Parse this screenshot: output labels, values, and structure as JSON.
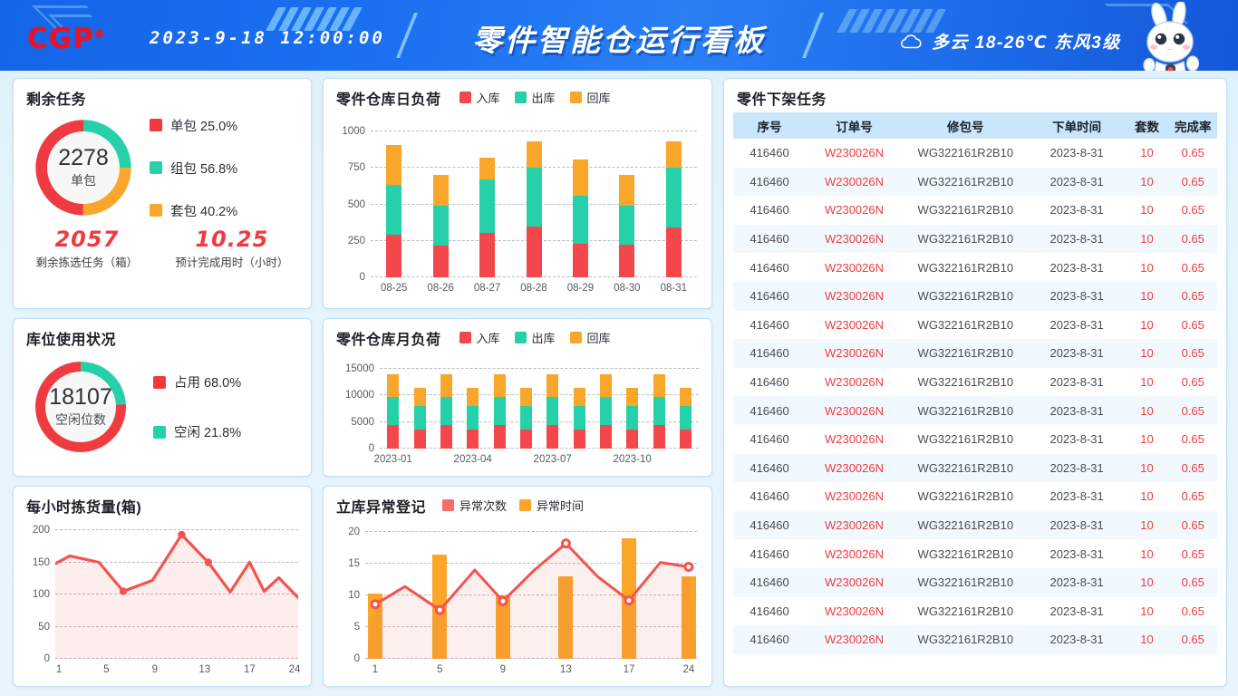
{
  "header": {
    "logo_text": "CGP",
    "logo_mark": "®",
    "datetime": "2023-9-18  12:00:00",
    "title": "零件智能仓运行看板",
    "weather_icon": "cloud-icon",
    "weather": "多云  18-26℃  东风3级",
    "mascot": "rabbit-mascot"
  },
  "remaining_tasks": {
    "title": "剩余任务",
    "donut": {
      "center_value": "2278",
      "center_label": "单包",
      "legend": [
        {
          "label": "单包 25.0%",
          "color": "#ef3b3f",
          "value": 25.0
        },
        {
          "label": "组包 56.8%",
          "color": "#26d0a8",
          "value": 56.8
        },
        {
          "label": "套包 40.2%",
          "color": "#f9a battery",
          "value": 40.2
        }
      ]
    },
    "kpis": [
      {
        "value": "2057",
        "label": "剩余拣选任务（箱）"
      },
      {
        "value": "10.25",
        "label": "预计完成用时（小时）"
      }
    ]
  },
  "location_usage": {
    "title": "库位使用状况",
    "donut": {
      "center_value": "18107",
      "center_label": "空闲位数",
      "legend": [
        {
          "label": "占用 68.0%",
          "color": "#ef3b3f",
          "value": 68.0
        },
        {
          "label": "空闲 21.8%",
          "color": "#26d0a8",
          "value": 21.8
        }
      ]
    }
  },
  "hourly_picking": {
    "title": "每小时拣货量(箱)"
  },
  "daily_load": {
    "title": "零件仓库日负荷"
  },
  "monthly_load": {
    "title": "零件仓库月负荷"
  },
  "anomaly": {
    "title": "立库异常登记"
  },
  "unload_table": {
    "title": "零件下架任务",
    "columns": [
      "序号",
      "订单号",
      "修包号",
      "下单时间",
      "套数",
      "完成率"
    ],
    "rows": [
      [
        "416460",
        "W230026N",
        "WG322161R2B10",
        "2023-8-31",
        "10",
        "0.65"
      ],
      [
        "416460",
        "W230026N",
        "WG322161R2B10",
        "2023-8-31",
        "10",
        "0.65"
      ],
      [
        "416460",
        "W230026N",
        "WG322161R2B10",
        "2023-8-31",
        "10",
        "0.65"
      ],
      [
        "416460",
        "W230026N",
        "WG322161R2B10",
        "2023-8-31",
        "10",
        "0.65"
      ],
      [
        "416460",
        "W230026N",
        "WG322161R2B10",
        "2023-8-31",
        "10",
        "0.65"
      ],
      [
        "416460",
        "W230026N",
        "WG322161R2B10",
        "2023-8-31",
        "10",
        "0.65"
      ],
      [
        "416460",
        "W230026N",
        "WG322161R2B10",
        "2023-8-31",
        "10",
        "0.65"
      ],
      [
        "416460",
        "W230026N",
        "WG322161R2B10",
        "2023-8-31",
        "10",
        "0.65"
      ],
      [
        "416460",
        "W230026N",
        "WG322161R2B10",
        "2023-8-31",
        "10",
        "0.65"
      ],
      [
        "416460",
        "W230026N",
        "WG322161R2B10",
        "2023-8-31",
        "10",
        "0.65"
      ],
      [
        "416460",
        "W230026N",
        "WG322161R2B10",
        "2023-8-31",
        "10",
        "0.65"
      ],
      [
        "416460",
        "W230026N",
        "WG322161R2B10",
        "2023-8-31",
        "10",
        "0.65"
      ],
      [
        "416460",
        "W230026N",
        "WG322161R2B10",
        "2023-8-31",
        "10",
        "0.65"
      ],
      [
        "416460",
        "W230026N",
        "WG322161R2B10",
        "2023-8-31",
        "10",
        "0.65"
      ],
      [
        "416460",
        "W230026N",
        "WG322161R2B10",
        "2023-8-31",
        "10",
        "0.65"
      ],
      [
        "416460",
        "W230026N",
        "WG322161R2B10",
        "2023-8-31",
        "10",
        "0.65"
      ],
      [
        "416460",
        "W230026N",
        "WG322161R2B10",
        "2023-8-31",
        "10",
        "0.65"
      ],
      [
        "416460",
        "W230026N",
        "WG322161R2B10",
        "2023-8-31",
        "10",
        "0.65"
      ]
    ]
  },
  "colors": {
    "in": "#f4474b",
    "out": "#26d0a8",
    "back": "#f9a62b",
    "line": "#f4534f",
    "accent": "#ef3b3f",
    "header_blue": "#1a6ef0",
    "table_head": "#c9e6fa"
  },
  "chart_data": [
    {
      "id": "remaining_tasks_donut",
      "type": "pie",
      "title": "剩余任务",
      "labels": [
        "单包",
        "组包",
        "套包"
      ],
      "values": [
        25.0,
        56.8,
        40.2
      ],
      "display_percent": [
        "25.0%",
        "56.8%",
        "40.2%"
      ],
      "colors": [
        "#ef3b3f",
        "#26d0a8",
        "#f9a62b"
      ],
      "arc_fractions": [
        0.5,
        0.25,
        0.25
      ],
      "center_value": 2278,
      "center_label": "单包",
      "legend_position": "right"
    },
    {
      "id": "location_usage_donut",
      "type": "pie",
      "title": "库位使用状况",
      "labels": [
        "占用",
        "空闲"
      ],
      "values": [
        68.0,
        21.8
      ],
      "display_percent": [
        "68.0%",
        "21.8%"
      ],
      "colors": [
        "#ef3b3f",
        "#26d0a8"
      ],
      "arc_fractions": [
        0.76,
        0.24
      ],
      "center_value": 18107,
      "center_label": "空闲位数",
      "legend_position": "right"
    },
    {
      "id": "hourly_picking",
      "type": "line",
      "title": "每小时拣货量(箱)",
      "x": [
        1,
        5,
        9,
        13,
        17,
        24
      ],
      "xlabel": "",
      "ylabel": "",
      "ylim": [
        0,
        200
      ],
      "yticks": [
        0,
        50,
        100,
        150,
        200
      ],
      "grid": true,
      "series": [
        {
          "name": "拣货量",
          "color": "#f4534f",
          "values": [
            148,
            105,
            193,
            104,
            92,
            95
          ],
          "marked_points": [
            {
              "x": 5,
              "y": 105
            },
            {
              "x": 9,
              "y": 193
            },
            {
              "x": 15,
              "y": 150
            }
          ]
        }
      ],
      "area_fill": true
    },
    {
      "id": "daily_load",
      "type": "bar",
      "title": "零件仓库日负荷",
      "stacked": true,
      "categories": [
        "08-25",
        "08-26",
        "08-27",
        "08-28",
        "08-29",
        "08-30",
        "08-31"
      ],
      "ylim": [
        0,
        1000
      ],
      "yticks": [
        0,
        250,
        500,
        750,
        1000
      ],
      "grid": true,
      "legend_position": "top",
      "series": [
        {
          "name": "入库",
          "color": "#f4474b",
          "values": [
            290,
            220,
            305,
            345,
            230,
            225,
            340
          ]
        },
        {
          "name": "出库",
          "color": "#26d0a8",
          "values": [
            345,
            270,
            365,
            405,
            330,
            265,
            410
          ]
        },
        {
          "name": "回库",
          "color": "#f9a62b",
          "values": [
            275,
            215,
            150,
            180,
            250,
            215,
            180
          ]
        }
      ],
      "totals": [
        910,
        705,
        820,
        930,
        810,
        705,
        930
      ]
    },
    {
      "id": "monthly_load",
      "type": "bar",
      "title": "零件仓库月负荷",
      "stacked": true,
      "categories": [
        "2023-01",
        "2023-02",
        "2023-03",
        "2023-04",
        "2023-05",
        "2023-06",
        "2023-07",
        "2023-08",
        "2023-09",
        "2023-10",
        "2023-11",
        "2023-12"
      ],
      "xticklabels": [
        "2023-01",
        "2023-04",
        "2023-07",
        "2023-10"
      ],
      "ylim": [
        0,
        15000
      ],
      "yticks": [
        0,
        5000,
        10000,
        15000
      ],
      "grid": true,
      "legend_position": "top",
      "series": [
        {
          "name": "入库",
          "color": "#f4474b",
          "values": [
            4500,
            3600,
            4500,
            3600,
            4500,
            3600,
            4500,
            3600,
            4500,
            3600,
            4500,
            3600
          ]
        },
        {
          "name": "出库",
          "color": "#26d0a8",
          "values": [
            5300,
            4400,
            5300,
            4400,
            5300,
            4400,
            5300,
            4400,
            5300,
            4400,
            5300,
            4400
          ]
        },
        {
          "name": "回库",
          "color": "#f9a62b",
          "values": [
            4200,
            3500,
            4200,
            3500,
            4200,
            3500,
            4200,
            3500,
            4200,
            3500,
            4200,
            3500
          ]
        }
      ],
      "totals": [
        14000,
        11500,
        14000,
        11500,
        14000,
        11500,
        14000,
        11500,
        14000,
        11500,
        14000,
        11500
      ]
    },
    {
      "id": "anomaly_register",
      "type": "bar",
      "title": "立库异常登记",
      "categories": [
        1,
        5,
        9,
        13,
        17,
        24
      ],
      "ylim": [
        0,
        20
      ],
      "yticks": [
        0,
        5,
        10,
        15,
        20
      ],
      "grid": true,
      "legend_position": "top",
      "series": [
        {
          "name": "异常时间",
          "color": "#f9a62b",
          "type": "bar",
          "values": [
            10.3,
            16.5,
            10.0,
            13.0,
            19.0,
            13.0
          ]
        },
        {
          "name": "异常次数",
          "color": "#f4534f",
          "type": "line",
          "values": [
            8.6,
            7.7,
            9.1,
            18.2,
            9.2,
            14.5
          ]
        }
      ]
    }
  ]
}
